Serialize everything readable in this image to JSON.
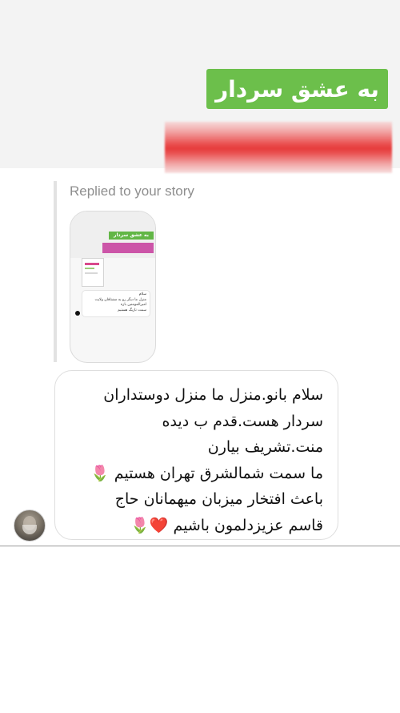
{
  "story": {
    "title": "به عشق سردار",
    "title_bg": "#6cbf4b",
    "redacted_color": "#e63c3c"
  },
  "reply": {
    "label": "Replied to your story"
  },
  "thumbnail": {
    "title": "به عشق سردار",
    "message_lines": [
      "سلام",
      "منزل ما دیگر رو به مشتاقان ولایت",
      "امیرالمومنین بازه",
      "سمت تازبگ هستیم"
    ]
  },
  "message": {
    "lines": [
      "سلام بانو.منزل ما منزل دوستداران",
      "سردار هست.قدم ب دیده",
      "منت.تشریف بیارن",
      "ما سمت شمالشرق تهران هستیم 🌷",
      "باعث افتخار میزبان میهمانان حاج",
      "قاسم عزیزدلمون باشیم ❤️🌷"
    ]
  },
  "icons": {
    "avatar": "user-avatar-icon"
  }
}
